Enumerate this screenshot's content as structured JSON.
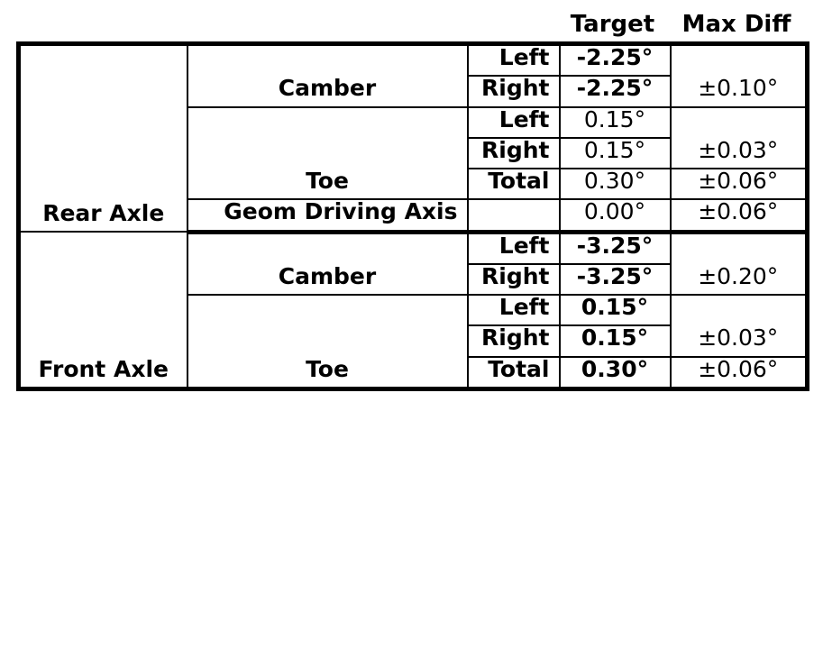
{
  "headers": {
    "target": "Target",
    "max_diff": "Max Diff"
  },
  "table": {
    "groups": [
      {
        "axle": "Rear Axle",
        "rows": [
          {
            "measurement": "Camber",
            "side": "Left",
            "target": "-2.25°",
            "max_diff": "±0.10°",
            "target_bold": true
          },
          {
            "measurement": "Camber",
            "side": "Right",
            "target": "-2.25°",
            "max_diff": "±0.10°",
            "target_bold": true
          },
          {
            "measurement": "Toe",
            "side": "Left",
            "target": "0.15°",
            "max_diff": "±0.03°",
            "target_bold": false
          },
          {
            "measurement": "Toe",
            "side": "Right",
            "target": "0.15°",
            "max_diff": "±0.03°",
            "target_bold": false
          },
          {
            "measurement": "Toe",
            "side": "Total",
            "target": "0.30°",
            "max_diff": "±0.06°",
            "target_bold": false
          },
          {
            "measurement": "Geom Driving Axis",
            "side": "",
            "target": "0.00°",
            "max_diff": "±0.06°",
            "target_bold": false
          }
        ]
      },
      {
        "axle": "Front Axle",
        "rows": [
          {
            "measurement": "Camber",
            "side": "Left",
            "target": "-3.25°",
            "max_diff": "±0.20°",
            "target_bold": true
          },
          {
            "measurement": "Camber",
            "side": "Right",
            "target": "-3.25°",
            "max_diff": "±0.20°",
            "target_bold": true
          },
          {
            "measurement": "Toe",
            "side": "Left",
            "target": "0.15°",
            "max_diff": "±0.03°",
            "target_bold": true
          },
          {
            "measurement": "Toe",
            "side": "Right",
            "target": "0.15°",
            "max_diff": "±0.03°",
            "target_bold": true
          },
          {
            "measurement": "Toe",
            "side": "Total",
            "target": "0.30°",
            "max_diff": "±0.06°",
            "target_bold": true
          }
        ]
      }
    ]
  }
}
